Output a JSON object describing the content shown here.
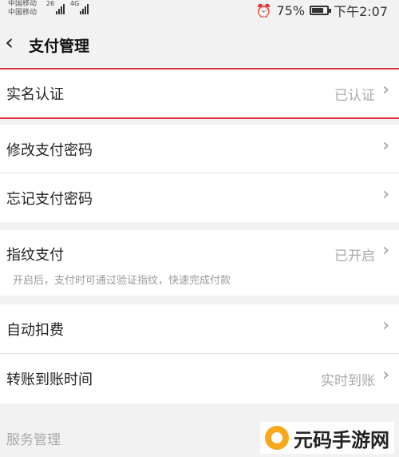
{
  "status_bar": {
    "carrier1": "中国移动",
    "carrier2": "中国移动",
    "network1": "26",
    "network2": "4G",
    "battery_percent": 75,
    "battery_text": "75%",
    "time": "下午2:07",
    "alarm_icon": "alarm-icon"
  },
  "navbar": {
    "title": "支付管理",
    "back_icon": "chevron-left-icon"
  },
  "rows": {
    "real_name": {
      "label": "实名认证",
      "value": "已认证"
    },
    "change_pwd": {
      "label": "修改支付密码"
    },
    "forgot_pwd": {
      "label": "忘记支付密码"
    },
    "fingerprint": {
      "label": "指纹支付",
      "value": "已开启",
      "hint": "开启后，支付时可通过验证指纹，快速完成付款"
    },
    "auto_debit": {
      "label": "自动扣费"
    },
    "transfer_time": {
      "label": "转账到账时间",
      "value": "实时到账"
    }
  },
  "section": {
    "service_title": "服务管理"
  },
  "watermark": {
    "text": "元码手游网"
  },
  "colors": {
    "highlight": "#d9303a",
    "background": "#f2f2f2"
  }
}
